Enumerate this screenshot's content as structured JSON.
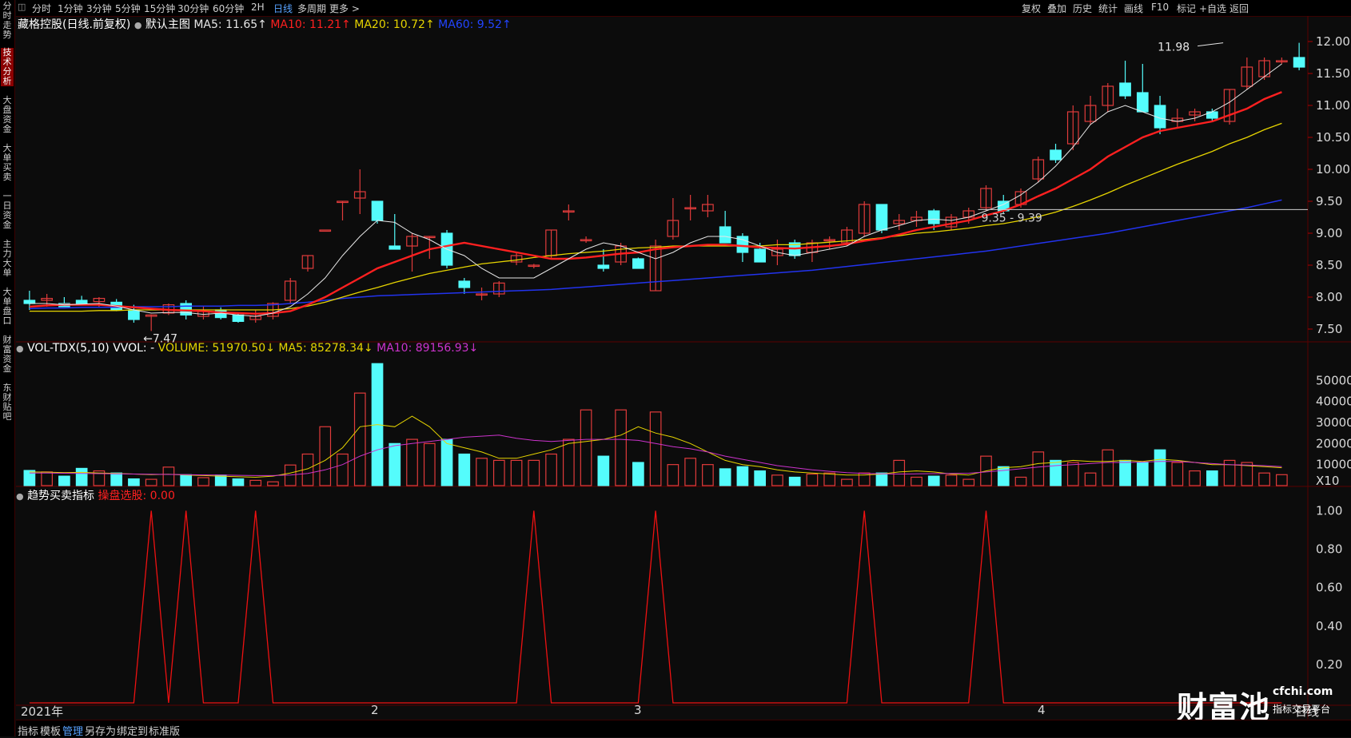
{
  "topbar": {
    "periods": [
      "分时",
      "1分钟",
      "3分钟",
      "5分钟",
      "15分钟",
      "30分钟",
      "60分钟",
      "2H",
      "日线",
      "多周期",
      "更多 >"
    ],
    "active_period": "日线",
    "tools": [
      "复权",
      "叠加",
      "历史",
      "统计",
      "画线",
      "F10",
      "标记",
      "+自选",
      "返回"
    ]
  },
  "sidebar": [
    "分时走势",
    "技术分析",
    "大盘资金",
    "大单买卖",
    "一日资金",
    "主力大单",
    "大单盘口",
    "财富资金",
    "东财贴吧"
  ],
  "sidebar_active": "技术分析",
  "main_header": {
    "stock": "藏格控股(日线.前复权)",
    "template": "默认主图",
    "ma5": "MA5: 11.65↑",
    "ma10": "MA10: 11.21↑",
    "ma20": "MA20: 10.72↑",
    "ma60": "MA60: 9.52↑"
  },
  "vol_header": {
    "name": "VOL-TDX(5,10) VVOL: -",
    "volume": "VOLUME: 51970.50↓",
    "ma5": "MA5: 85278.34↓",
    "ma10": "MA10: 89156.93↓"
  },
  "ind_header": {
    "name": "趋势买卖指标",
    "value": "操盘选股: 0.00"
  },
  "annotations": {
    "high": "11.98",
    "low": "←7.47",
    "range": "9.35 - 9.39"
  },
  "price_axis": [
    "12.00",
    "11.50",
    "11.00",
    "10.50",
    "10.00",
    "9.50",
    "9.00",
    "8.50",
    "8.00",
    "7.50"
  ],
  "vol_axis": [
    "50000",
    "40000",
    "30000",
    "20000",
    "10000",
    "X10"
  ],
  "ind_axis": [
    "1.00",
    "0.80",
    "0.60",
    "0.40",
    "0.20"
  ],
  "x_labels": [
    "2021年",
    "2",
    "3",
    "4"
  ],
  "axis_corner": "日线",
  "bottombar": [
    "指标",
    "模板",
    "管理",
    "另存为",
    "绑定到",
    "标准版"
  ],
  "bottom_active": "管理",
  "watermark": {
    "brand": "财富池",
    "site": "cfchi.com",
    "slogan": "指标交易平台"
  },
  "colors": {
    "up": "#e03b3b",
    "down": "#54fcfc",
    "ma5": "#e6e6e6",
    "ma10": "#ff2020",
    "ma20": "#e6d400",
    "ma60": "#2233ee",
    "vol_ma10": "#cc33cc",
    "signal": "#ee1111"
  },
  "chart_data": {
    "type": "candlestick",
    "x_range": [
      "2021-01",
      "2021-04"
    ],
    "price_range": [
      7.3,
      12.1
    ],
    "candles": [
      {
        "o": 7.95,
        "h": 8.1,
        "l": 7.8,
        "c": 7.9
      },
      {
        "o": 7.95,
        "h": 8.05,
        "l": 7.85,
        "c": 7.98
      },
      {
        "o": 7.9,
        "h": 8.0,
        "l": 7.85,
        "c": 7.85
      },
      {
        "o": 7.95,
        "h": 8.02,
        "l": 7.88,
        "c": 7.9
      },
      {
        "o": 7.93,
        "h": 8.0,
        "l": 7.85,
        "c": 7.98
      },
      {
        "o": 7.92,
        "h": 7.97,
        "l": 7.78,
        "c": 7.8
      },
      {
        "o": 7.8,
        "h": 7.88,
        "l": 7.6,
        "c": 7.65
      },
      {
        "o": 7.7,
        "h": 7.73,
        "l": 7.47,
        "c": 7.72
      },
      {
        "o": 7.75,
        "h": 7.9,
        "l": 7.72,
        "c": 7.88
      },
      {
        "o": 7.9,
        "h": 7.95,
        "l": 7.65,
        "c": 7.72
      },
      {
        "o": 7.7,
        "h": 7.85,
        "l": 7.65,
        "c": 7.78
      },
      {
        "o": 7.8,
        "h": 7.84,
        "l": 7.65,
        "c": 7.68
      },
      {
        "o": 7.72,
        "h": 7.75,
        "l": 7.6,
        "c": 7.62
      },
      {
        "o": 7.65,
        "h": 7.8,
        "l": 7.6,
        "c": 7.7
      },
      {
        "o": 7.7,
        "h": 7.92,
        "l": 7.65,
        "c": 7.9
      },
      {
        "o": 7.95,
        "h": 8.3,
        "l": 7.9,
        "c": 8.25
      },
      {
        "o": 8.45,
        "h": 8.65,
        "l": 8.4,
        "c": 8.65
      },
      {
        "o": 9.05,
        "h": 9.05,
        "l": 9.05,
        "c": 9.05
      },
      {
        "o": 9.5,
        "h": 9.5,
        "l": 9.2,
        "c": 9.5
      },
      {
        "o": 9.55,
        "h": 10.0,
        "l": 9.3,
        "c": 9.65
      },
      {
        "o": 9.5,
        "h": 9.5,
        "l": 9.15,
        "c": 9.2
      },
      {
        "o": 8.8,
        "h": 9.3,
        "l": 8.75,
        "c": 8.75
      },
      {
        "o": 8.8,
        "h": 9.0,
        "l": 8.4,
        "c": 8.95
      },
      {
        "o": 8.95,
        "h": 8.95,
        "l": 8.6,
        "c": 8.95
      },
      {
        "o": 9.0,
        "h": 9.05,
        "l": 8.45,
        "c": 8.5
      },
      {
        "o": 8.25,
        "h": 8.3,
        "l": 8.05,
        "c": 8.15
      },
      {
        "o": 8.05,
        "h": 8.15,
        "l": 7.95,
        "c": 8.05
      },
      {
        "o": 8.05,
        "h": 8.25,
        "l": 8.0,
        "c": 8.22
      },
      {
        "o": 8.55,
        "h": 8.7,
        "l": 8.5,
        "c": 8.65
      },
      {
        "o": 8.5,
        "h": 8.52,
        "l": 8.45,
        "c": 8.5
      },
      {
        "o": 8.65,
        "h": 9.05,
        "l": 8.6,
        "c": 9.05
      },
      {
        "o": 9.35,
        "h": 9.45,
        "l": 9.2,
        "c": 9.35
      },
      {
        "o": 8.9,
        "h": 8.95,
        "l": 8.85,
        "c": 8.9
      },
      {
        "o": 8.5,
        "h": 8.75,
        "l": 8.4,
        "c": 8.45
      },
      {
        "o": 8.55,
        "h": 8.85,
        "l": 8.5,
        "c": 8.8
      },
      {
        "o": 8.6,
        "h": 8.62,
        "l": 8.45,
        "c": 8.45
      },
      {
        "o": 8.1,
        "h": 8.9,
        "l": 8.1,
        "c": 8.8
      },
      {
        "o": 8.95,
        "h": 9.55,
        "l": 8.9,
        "c": 9.2
      },
      {
        "o": 9.4,
        "h": 9.6,
        "l": 9.2,
        "c": 9.4
      },
      {
        "o": 9.35,
        "h": 9.6,
        "l": 9.25,
        "c": 9.45
      },
      {
        "o": 9.1,
        "h": 9.35,
        "l": 8.85,
        "c": 8.85
      },
      {
        "o": 8.95,
        "h": 9.0,
        "l": 8.55,
        "c": 8.7
      },
      {
        "o": 8.75,
        "h": 8.85,
        "l": 8.55,
        "c": 8.55
      },
      {
        "o": 8.65,
        "h": 8.9,
        "l": 8.5,
        "c": 8.75
      },
      {
        "o": 8.85,
        "h": 8.9,
        "l": 8.6,
        "c": 8.65
      },
      {
        "o": 8.7,
        "h": 8.9,
        "l": 8.55,
        "c": 8.85
      },
      {
        "o": 8.9,
        "h": 8.95,
        "l": 8.75,
        "c": 8.9
      },
      {
        "o": 8.85,
        "h": 9.1,
        "l": 8.8,
        "c": 9.05
      },
      {
        "o": 9.0,
        "h": 9.5,
        "l": 8.95,
        "c": 9.45
      },
      {
        "o": 9.45,
        "h": 9.45,
        "l": 9.0,
        "c": 9.05
      },
      {
        "o": 9.15,
        "h": 9.3,
        "l": 9.05,
        "c": 9.2
      },
      {
        "o": 9.2,
        "h": 9.35,
        "l": 9.1,
        "c": 9.25
      },
      {
        "o": 9.35,
        "h": 9.38,
        "l": 9.05,
        "c": 9.15
      },
      {
        "o": 9.1,
        "h": 9.3,
        "l": 9.05,
        "c": 9.25
      },
      {
        "o": 9.25,
        "h": 9.4,
        "l": 9.15,
        "c": 9.35
      },
      {
        "o": 9.4,
        "h": 9.75,
        "l": 9.35,
        "c": 9.7
      },
      {
        "o": 9.5,
        "h": 9.6,
        "l": 9.3,
        "c": 9.35
      },
      {
        "o": 9.45,
        "h": 9.7,
        "l": 9.4,
        "c": 9.65
      },
      {
        "o": 9.85,
        "h": 10.2,
        "l": 9.8,
        "c": 10.15
      },
      {
        "o": 10.3,
        "h": 10.4,
        "l": 10.1,
        "c": 10.15
      },
      {
        "o": 10.4,
        "h": 11.0,
        "l": 10.3,
        "c": 10.9
      },
      {
        "o": 10.75,
        "h": 11.15,
        "l": 10.7,
        "c": 11.0
      },
      {
        "o": 11.0,
        "h": 11.35,
        "l": 10.9,
        "c": 11.3
      },
      {
        "o": 11.35,
        "h": 11.7,
        "l": 11.1,
        "c": 11.15
      },
      {
        "o": 11.2,
        "h": 11.65,
        "l": 10.9,
        "c": 10.9
      },
      {
        "o": 11.0,
        "h": 11.15,
        "l": 10.55,
        "c": 10.65
      },
      {
        "o": 10.75,
        "h": 10.95,
        "l": 10.65,
        "c": 10.8
      },
      {
        "o": 10.85,
        "h": 10.95,
        "l": 10.75,
        "c": 10.9
      },
      {
        "o": 10.9,
        "h": 10.95,
        "l": 10.75,
        "c": 10.8
      },
      {
        "o": 10.75,
        "h": 11.25,
        "l": 10.7,
        "c": 11.25
      },
      {
        "o": 11.3,
        "h": 11.75,
        "l": 11.25,
        "c": 11.6
      },
      {
        "o": 11.45,
        "h": 11.75,
        "l": 11.4,
        "c": 11.7
      },
      {
        "o": 11.7,
        "h": 11.75,
        "l": 11.65,
        "c": 11.7
      },
      {
        "o": 11.75,
        "h": 11.98,
        "l": 11.55,
        "c": 11.6
      }
    ],
    "ma5": [
      7.9,
      7.9,
      7.88,
      7.89,
      7.9,
      7.86,
      7.8,
      7.75,
      7.76,
      7.76,
      7.73,
      7.75,
      7.72,
      7.7,
      7.75,
      7.85,
      8.05,
      8.3,
      8.65,
      8.95,
      9.2,
      9.17,
      9.0,
      8.9,
      8.75,
      8.65,
      8.45,
      8.3,
      8.3,
      8.3,
      8.45,
      8.6,
      8.75,
      8.85,
      8.8,
      8.7,
      8.6,
      8.7,
      8.85,
      8.95,
      8.95,
      8.9,
      8.8,
      8.7,
      8.65,
      8.7,
      8.75,
      8.8,
      8.95,
      9.05,
      9.12,
      9.2,
      9.22,
      9.2,
      9.25,
      9.35,
      9.45,
      9.6,
      9.8,
      10.05,
      10.35,
      10.7,
      10.9,
      11.0,
      10.9,
      10.8,
      10.75,
      10.8,
      10.9,
      11.05,
      11.25,
      11.45,
      11.65
    ],
    "ma10": [
      7.85,
      7.87,
      7.88,
      7.88,
      7.88,
      7.86,
      7.84,
      7.82,
      7.8,
      7.79,
      7.78,
      7.76,
      7.75,
      7.74,
      7.75,
      7.78,
      7.88,
      8.0,
      8.15,
      8.3,
      8.45,
      8.55,
      8.65,
      8.75,
      8.8,
      8.85,
      8.8,
      8.75,
      8.7,
      8.65,
      8.6,
      8.6,
      8.62,
      8.65,
      8.68,
      8.7,
      8.75,
      8.78,
      8.8,
      8.82,
      8.82,
      8.8,
      8.78,
      8.77,
      8.76,
      8.78,
      8.8,
      8.83,
      8.88,
      8.92,
      8.98,
      9.05,
      9.1,
      9.15,
      9.2,
      9.28,
      9.35,
      9.45,
      9.58,
      9.7,
      9.85,
      10.0,
      10.2,
      10.35,
      10.5,
      10.6,
      10.65,
      10.7,
      10.75,
      10.85,
      10.95,
      11.1,
      11.21
    ],
    "ma20": [
      7.78,
      7.78,
      7.78,
      7.78,
      7.79,
      7.79,
      7.8,
      7.8,
      7.8,
      7.8,
      7.8,
      7.8,
      7.8,
      7.8,
      7.8,
      7.82,
      7.86,
      7.92,
      8.0,
      8.08,
      8.15,
      8.23,
      8.3,
      8.37,
      8.42,
      8.47,
      8.52,
      8.55,
      8.58,
      8.62,
      8.65,
      8.68,
      8.7,
      8.72,
      8.75,
      8.77,
      8.78,
      8.8,
      8.8,
      8.8,
      8.8,
      8.8,
      8.8,
      8.82,
      8.82,
      8.84,
      8.86,
      8.88,
      8.9,
      8.93,
      8.96,
      9.0,
      9.02,
      9.05,
      9.08,
      9.12,
      9.15,
      9.2,
      9.26,
      9.33,
      9.42,
      9.52,
      9.63,
      9.75,
      9.86,
      9.97,
      10.08,
      10.18,
      10.28,
      10.4,
      10.5,
      10.62,
      10.72
    ],
    "ma60": [
      7.82,
      7.83,
      7.83,
      7.84,
      7.84,
      7.84,
      7.85,
      7.85,
      7.85,
      7.86,
      7.86,
      7.86,
      7.87,
      7.87,
      7.88,
      7.9,
      7.92,
      7.95,
      7.98,
      8.0,
      8.02,
      8.03,
      8.04,
      8.05,
      8.06,
      8.07,
      8.08,
      8.09,
      8.1,
      8.11,
      8.12,
      8.14,
      8.16,
      8.18,
      8.2,
      8.22,
      8.24,
      8.26,
      8.28,
      8.3,
      8.32,
      8.34,
      8.36,
      8.38,
      8.4,
      8.42,
      8.45,
      8.48,
      8.51,
      8.54,
      8.57,
      8.6,
      8.63,
      8.66,
      8.69,
      8.72,
      8.76,
      8.8,
      8.84,
      8.88,
      8.92,
      8.96,
      9.0,
      9.05,
      9.1,
      9.15,
      9.2,
      9.25,
      9.3,
      9.35,
      9.4,
      9.46,
      9.52
    ],
    "volume_x10": [
      7200,
      6500,
      4500,
      8200,
      7000,
      6000,
      3200,
      3000,
      8800,
      5200,
      3800,
      5000,
      3200,
      2500,
      1800,
      9800,
      15000,
      28000,
      15000,
      44000,
      58000,
      20000,
      22000,
      20000,
      22000,
      15000,
      13000,
      12000,
      12000,
      12000,
      15000,
      22000,
      36000,
      14000,
      36000,
      11000,
      35000,
      10000,
      13000,
      10000,
      8000,
      9000,
      7000,
      5000,
      4000,
      5500,
      6000,
      3000,
      6000,
      6000,
      12000,
      4000,
      4500,
      5000,
      3000,
      14000,
      9000,
      4000,
      16000,
      12000,
      11000,
      6000,
      17000,
      12000,
      11000,
      17000,
      11000,
      7000,
      7000,
      12000,
      11000,
      6000,
      5200
    ],
    "vol_ma5_x10": [
      6500,
      6400,
      6200,
      6300,
      6000,
      5800,
      5500,
      5200,
      5400,
      5000,
      4800,
      4500,
      4200,
      4000,
      4500,
      6000,
      8000,
      12000,
      18000,
      28000,
      29000,
      28000,
      33000,
      28000,
      20000,
      18000,
      16000,
      13000,
      13000,
      15000,
      17000,
      20000,
      21000,
      22000,
      24000,
      28000,
      25000,
      23000,
      20000,
      16000,
      12000,
      10000,
      9000,
      7500,
      6500,
      6000,
      5500,
      5000,
      5000,
      5500,
      6500,
      7000,
      6500,
      5500,
      5000,
      7000,
      8500,
      9000,
      10500,
      11000,
      12000,
      11500,
      11500,
      12000,
      11500,
      12500,
      12000,
      11000,
      10000,
      10000,
      9500,
      9000,
      8500
    ],
    "vol_ma10_x10": [
      6000,
      6000,
      5900,
      5800,
      5700,
      5600,
      5500,
      5400,
      5300,
      5200,
      5100,
      5000,
      4900,
      4800,
      4800,
      5000,
      5800,
      7500,
      10000,
      14000,
      17000,
      19000,
      20000,
      21000,
      22000,
      23000,
      23500,
      24000,
      22500,
      21500,
      21000,
      21500,
      22000,
      22000,
      22000,
      21500,
      20000,
      18500,
      17500,
      16000,
      14000,
      12500,
      11000,
      9500,
      8500,
      7500,
      6800,
      6200,
      5800,
      5600,
      5500,
      5600,
      5700,
      5800,
      5900,
      6500,
      7200,
      8000,
      8800,
      9500,
      10000,
      10500,
      11000,
      11000,
      11200,
      11500,
      11500,
      11000,
      10500,
      10000,
      9800,
      9500,
      9000
    ],
    "signal": [
      0,
      0,
      0,
      0,
      0,
      0,
      0,
      1,
      0,
      1,
      0,
      0,
      0,
      1,
      0,
      0,
      0,
      0,
      0,
      0,
      0,
      0,
      0,
      0,
      0,
      0,
      0,
      0,
      0,
      1,
      0,
      0,
      0,
      0,
      0,
      0,
      1,
      0,
      0,
      0,
      0,
      0,
      0,
      0,
      0,
      0,
      0,
      0,
      1,
      0,
      0,
      0,
      0,
      0,
      0,
      1,
      0,
      0,
      0,
      0,
      0,
      0,
      0,
      0,
      0,
      0,
      0,
      0,
      0,
      0,
      0,
      0,
      0
    ],
    "support_line": 9.37,
    "xlim": [
      0,
      72
    ]
  }
}
